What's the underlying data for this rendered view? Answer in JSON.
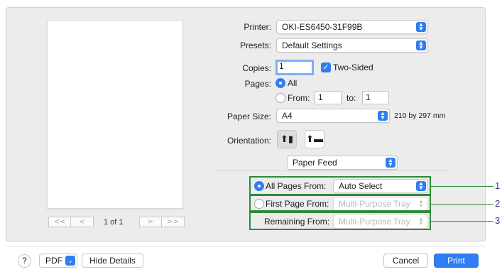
{
  "printer": {
    "label": "Printer:",
    "value": "OKI-ES6450-31F99B"
  },
  "presets": {
    "label": "Presets:",
    "value": "Default Settings"
  },
  "copies": {
    "label": "Copies:",
    "value": "1",
    "two_sided_label": "Two-Sided",
    "two_sided_checked": true
  },
  "pages": {
    "label": "Pages:",
    "all_label": "All",
    "from_label": "From:",
    "from_value": "1",
    "to_label": "to:",
    "to_value": "1"
  },
  "paper_size": {
    "label": "Paper Size:",
    "value": "A4",
    "dimensions": "210 by 297 mm"
  },
  "orientation": {
    "label": "Orientation:"
  },
  "section": {
    "value": "Paper Feed"
  },
  "paper_feed": {
    "all_pages_label": "All Pages From:",
    "all_pages_value": "Auto Select",
    "first_page_label": "First Page From:",
    "first_page_value": "Multi-Purpose Tray",
    "remaining_label": "Remaining From:",
    "remaining_value": "Multi-Purpose Tray"
  },
  "callouts": [
    "1",
    "2",
    "3"
  ],
  "preview": {
    "page_count": "1 of 1",
    "first": "<<",
    "prev": "<",
    "next": ">",
    "last": ">>"
  },
  "footer": {
    "help": "?",
    "pdf": "PDF",
    "hide_details": "Hide Details",
    "cancel": "Cancel",
    "print": "Print"
  },
  "colors": {
    "accent": "#2f7ef3",
    "callout": "#2e8b3a"
  }
}
